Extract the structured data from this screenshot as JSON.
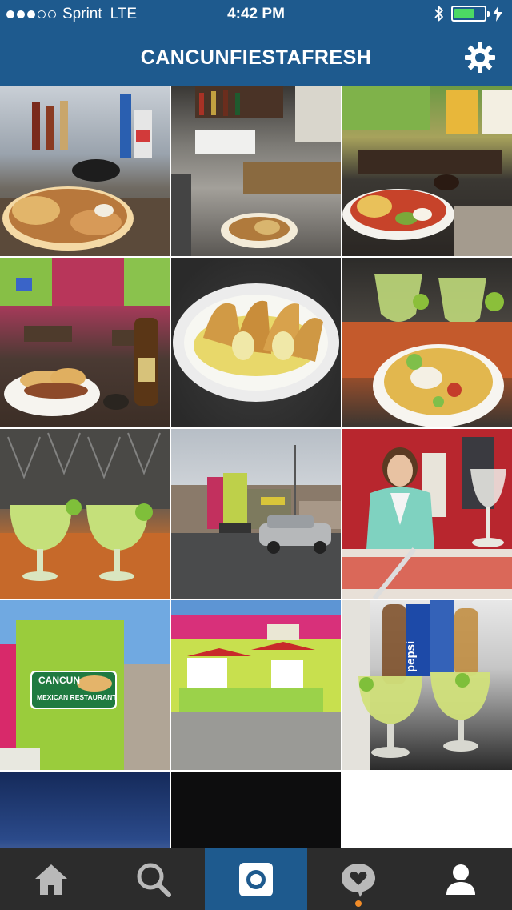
{
  "status_bar": {
    "carrier": "Sprint",
    "network": "LTE",
    "time": "4:42 PM",
    "signal_dots_filled": 3,
    "signal_dots_total": 5,
    "battery_level": 0.7
  },
  "header": {
    "title": "CANCUNFIESTAFRESH",
    "settings_icon": "gear-icon"
  },
  "grid": {
    "photos": [
      {
        "alt": "bar counter with plated taco meal and drinks"
      },
      {
        "alt": "kitchen pass with plated food and bottles"
      },
      {
        "alt": "dining room with nacho plate"
      },
      {
        "alt": "dining room with sandwich and beer"
      },
      {
        "alt": "plate of hard shell tacos"
      },
      {
        "alt": "margaritas and loaded nachos"
      },
      {
        "alt": "two lime margaritas"
      },
      {
        "alt": "restaurant exterior street view"
      },
      {
        "alt": "smiling server at counter"
      },
      {
        "alt": "Cancun Mexican Restaurant sign",
        "sign_line1": "CANCUN",
        "sign_line2": "MEXICAN RESTAURANT"
      },
      {
        "alt": "lime green building patio with umbrellas"
      },
      {
        "alt": "margaritas with beer bottles",
        "label": "pepsi"
      },
      {
        "alt": "night sky"
      },
      {
        "alt": "dark night photo"
      },
      {
        "alt": "empty"
      }
    ]
  },
  "tab_bar": {
    "tabs": [
      {
        "name": "home",
        "icon": "home-icon",
        "active": false
      },
      {
        "name": "search",
        "icon": "search-icon",
        "active": false
      },
      {
        "name": "camera",
        "icon": "camera-icon",
        "active": true
      },
      {
        "name": "activity",
        "icon": "heart-bubble-icon",
        "active": false,
        "notification": true
      },
      {
        "name": "profile",
        "icon": "profile-icon",
        "active": false
      }
    ]
  },
  "colors": {
    "brand_blue": "#1e5a8e",
    "tab_bar_bg": "#2c2c2c",
    "battery_green": "#4cd964",
    "notification_orange": "#f28c28"
  }
}
